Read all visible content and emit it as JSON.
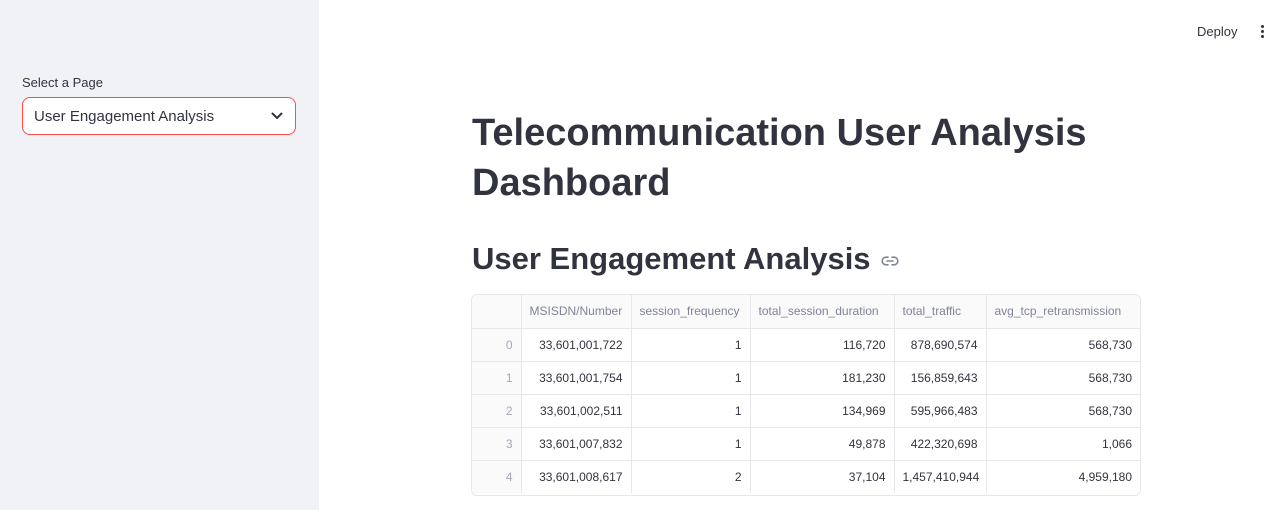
{
  "sidebar": {
    "select_label": "Select a Page",
    "selected_page": "User Engagement Analysis"
  },
  "toolbar": {
    "deploy_label": "Deploy"
  },
  "main": {
    "title": "Telecommunication User Analysis Dashboard",
    "subtitle": "User Engagement Analysis"
  },
  "table": {
    "columns": [
      "",
      "MSISDN/Number",
      "session_frequency",
      "total_session_duration",
      "total_traffic",
      "avg_tcp_retransmission"
    ],
    "rows": [
      [
        "0",
        "33,601,001,722",
        "1",
        "116,720",
        "878,690,574",
        "568,730"
      ],
      [
        "1",
        "33,601,001,754",
        "1",
        "181,230",
        "156,859,643",
        "568,730"
      ],
      [
        "2",
        "33,601,002,511",
        "1",
        "134,969",
        "595,966,483",
        "568,730"
      ],
      [
        "3",
        "33,601,007,832",
        "1",
        "49,878",
        "422,320,698",
        "1,066"
      ],
      [
        "4",
        "33,601,008,617",
        "2",
        "37,104",
        "1,457,410,944",
        "4,959,180"
      ]
    ]
  },
  "colors": {
    "accent": "#ff4b4b",
    "sidebar_bg": "#f0f2f6",
    "text": "#31333f"
  }
}
